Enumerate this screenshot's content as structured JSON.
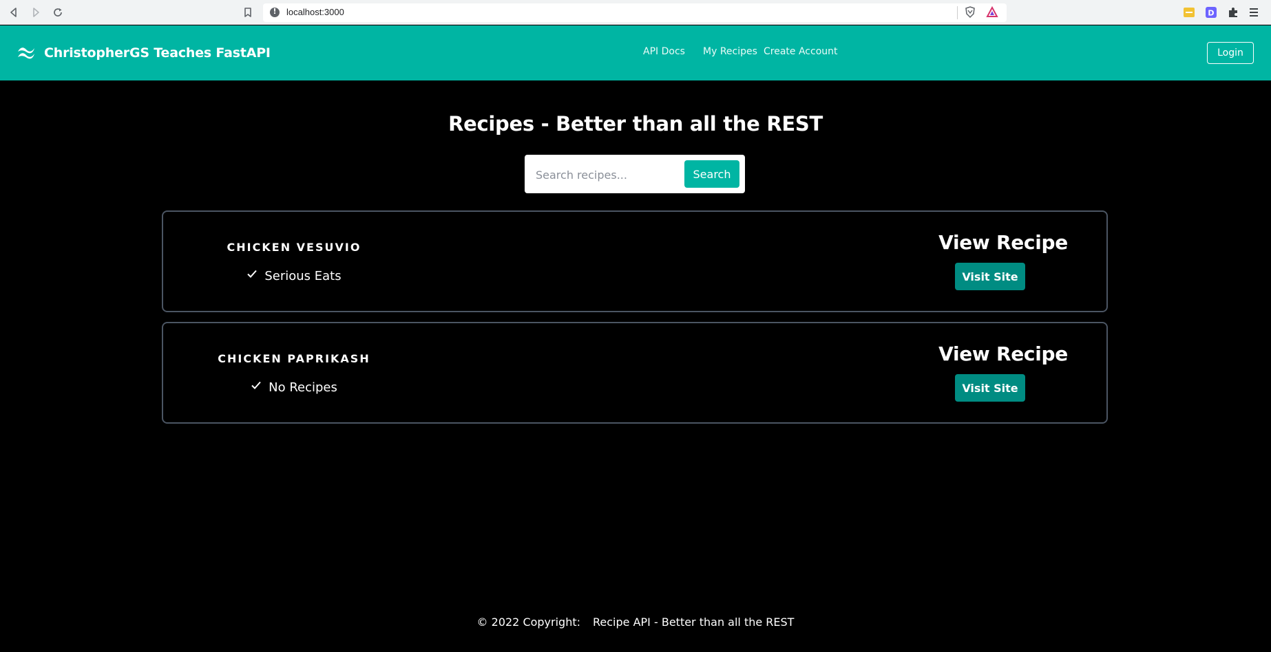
{
  "browser": {
    "url": "localhost:3000"
  },
  "header": {
    "brand_title": "ChristopherGS Teaches FastAPI",
    "nav": [
      {
        "label": "API Docs"
      },
      {
        "label": "My Recipes"
      },
      {
        "label": "Create Account"
      }
    ],
    "login_label": "Login"
  },
  "main": {
    "title": "Recipes - Better than all the REST",
    "search": {
      "placeholder": "Search recipes...",
      "value": "",
      "button_label": "Search"
    },
    "recipes": [
      {
        "name": "CHICKEN VESUVIO",
        "source": "Serious Eats",
        "view_label": "View Recipe",
        "visit_label": "Visit Site"
      },
      {
        "name": "CHICKEN PAPRIKASH",
        "source": "No Recipes",
        "view_label": "View Recipe",
        "visit_label": "Visit Site"
      }
    ]
  },
  "footer": {
    "copyright": "© 2022 Copyright:",
    "site_name": "Recipe API - Better than all the REST"
  },
  "colors": {
    "header_bg": "#00b5a3",
    "page_bg": "#000000",
    "visit_button": "#008c82",
    "card_border": "#4b5563"
  },
  "icons": {
    "back": "arrow-left-icon",
    "forward": "arrow-right-icon",
    "reload": "reload-icon",
    "bookmark": "bookmark-icon",
    "site_info": "info-icon",
    "brave": "brave-shield-icon",
    "rewards": "triangle-rewards-icon",
    "brand": "wave-logo-icon",
    "check": "check-icon"
  }
}
